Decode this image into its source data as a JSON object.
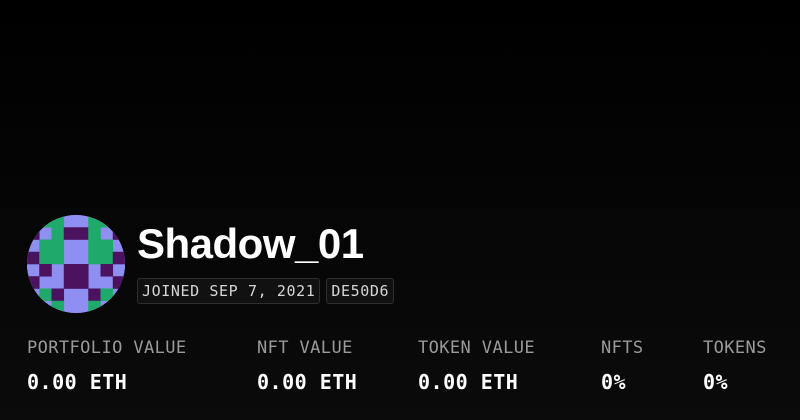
{
  "profile": {
    "username": "Shadow_01",
    "joined": "JOINED SEP 7, 2021",
    "id_badge": "DE50D6",
    "avatar_icon": "pixel-avatar-icon",
    "avatar_colors": {
      "background": "#8f8ff2",
      "green": "#1faa6b",
      "purple": "#4b1260"
    }
  },
  "stats": [
    {
      "label": "PORTFOLIO VALUE",
      "value": "0.00 ETH"
    },
    {
      "label": "NFT VALUE",
      "value": "0.00 ETH"
    },
    {
      "label": "TOKEN VALUE",
      "value": "0.00 ETH"
    },
    {
      "label": "NFTS",
      "value": "0%"
    },
    {
      "label": "TOKENS",
      "value": "0%"
    }
  ]
}
